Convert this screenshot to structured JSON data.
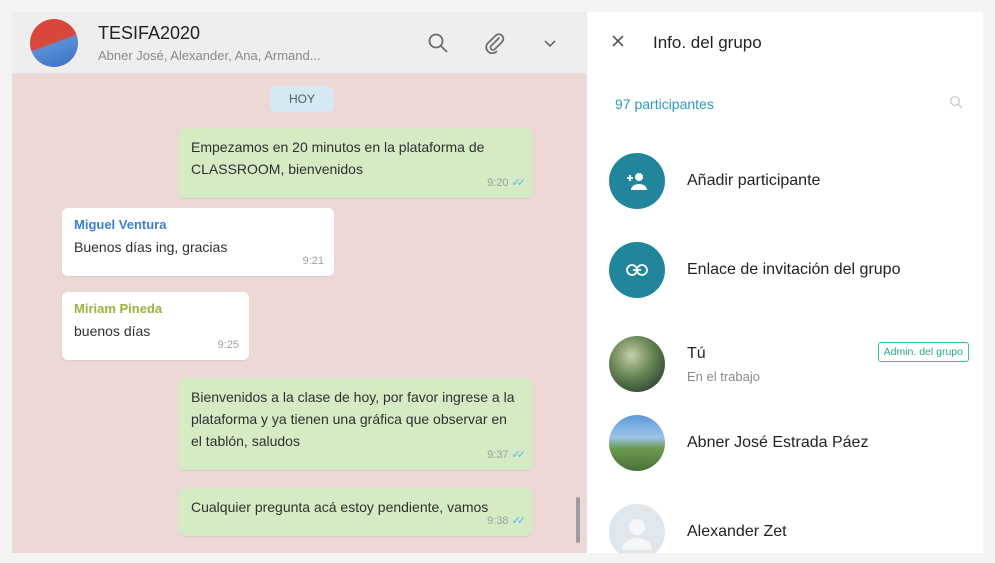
{
  "chat": {
    "title": "TESIFA2020",
    "members": "Abner José, Alexander, Ana, Armand...",
    "day_label": "HOY",
    "messages": [
      {
        "text": "Empezamos en 20 minutos en la plataforma de CLASSROOM, bienvenidos",
        "time": "9:20"
      },
      {
        "sender": "Miguel Ventura",
        "sender_color": "#3d7fd6",
        "text": "Buenos días ing, gracias",
        "time": "9:21"
      },
      {
        "sender": "Miriam Pineda",
        "sender_color": "#9ab33a",
        "text": "buenos días",
        "time": "9:25"
      },
      {
        "text": "Bienvenidos a la clase de hoy, por favor ingrese a la plataforma y ya tienen una gráfica que observar en el tablón, saludos",
        "time": "9:37"
      },
      {
        "text": "Cualquier pregunta acá estoy pendiente, vamos",
        "time": "9:38"
      }
    ],
    "icons": [
      "search-icon",
      "attach-icon",
      "chevron-down-icon"
    ]
  },
  "info": {
    "title": "Info. del grupo",
    "participants_count": "97 participantes",
    "add_participant": "Añadir participante",
    "invite_link": "Enlace de invitación del grupo",
    "members": [
      {
        "name": "Tú",
        "status": "En el trabajo",
        "badge": "Admin. del grupo"
      },
      {
        "name": "Abner José Estrada Páez"
      },
      {
        "name": "Alexander Zet"
      }
    ]
  },
  "colors": {
    "accent": "#21859c",
    "outgoing": "#d4ebc4",
    "chat_bg": "#ecd8d4",
    "ticks": "#4fb6ec"
  }
}
